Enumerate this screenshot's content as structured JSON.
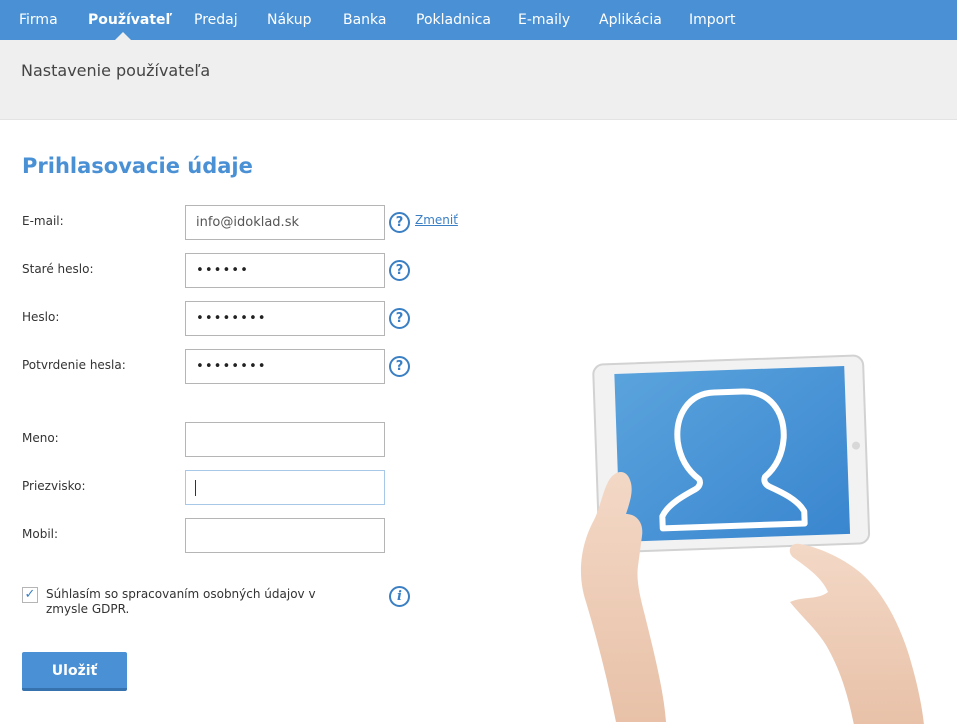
{
  "nav": {
    "items": [
      "Firma",
      "Používateľ",
      "Predaj",
      "Nákup",
      "Banka",
      "Pokladnica",
      "E-maily",
      "Aplikácia",
      "Import"
    ],
    "active": "Používateľ"
  },
  "page": {
    "title": "Nastavenie používateľa"
  },
  "login": {
    "section_title": "Prihlasovacie údaje",
    "email_label": "E-mail:",
    "email_value": "info@idoklad.sk",
    "change_link": "Zmeniť",
    "old_password_label": "Staré heslo:",
    "old_password_value": "••••••",
    "password_label": "Heslo:",
    "password_value": "••••••••",
    "confirm_label": "Potvrdenie hesla:",
    "confirm_value": "••••••••"
  },
  "personal": {
    "name_label": "Meno:",
    "name_value": "",
    "surname_label": "Priezvisko:",
    "surname_value": "",
    "mobile_label": "Mobil:",
    "mobile_value": ""
  },
  "gdpr": {
    "text": "Súhlasím so spracovaním osobných údajov v zmysle GDPR.",
    "checked": true
  },
  "save_label": "Uložiť",
  "icons": {
    "help": "question-circle-icon",
    "info": "info-circle-icon",
    "check": "checkmark-icon"
  },
  "colors": {
    "accent": "#4a90d4",
    "link": "#3a7fc4"
  }
}
